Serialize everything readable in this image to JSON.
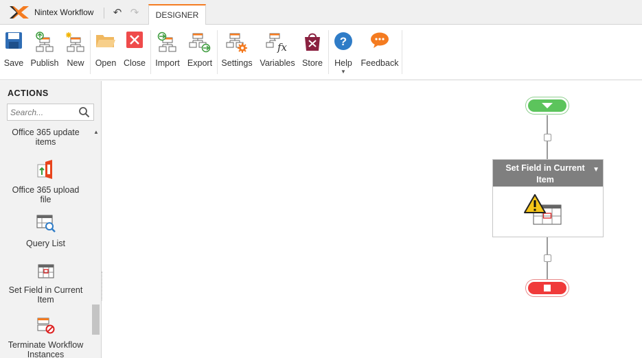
{
  "app": {
    "title": "Nintex Workflow"
  },
  "tabs": [
    {
      "label": "DESIGNER"
    }
  ],
  "ribbon": {
    "buttons": [
      {
        "label": "Save",
        "icon": "save-icon"
      },
      {
        "label": "Publish",
        "icon": "publish-icon"
      },
      {
        "label": "New",
        "icon": "new-workflow-icon"
      },
      {
        "label": "Open",
        "icon": "folder-icon"
      },
      {
        "label": "Close",
        "icon": "close-icon"
      },
      {
        "label": "Import",
        "icon": "import-icon"
      },
      {
        "label": "Export",
        "icon": "export-icon"
      },
      {
        "label": "Settings",
        "icon": "settings-icon"
      },
      {
        "label": "Variables",
        "icon": "variables-icon"
      },
      {
        "label": "Store",
        "icon": "store-icon"
      },
      {
        "label": "Help",
        "icon": "help-icon"
      },
      {
        "label": "Feedback",
        "icon": "feedback-icon"
      }
    ]
  },
  "actions_panel": {
    "title": "ACTIONS",
    "search_placeholder": "Search...",
    "items": [
      {
        "label": "Office 365 update items",
        "icon": "office365-update-icon"
      },
      {
        "label": "Office 365 upload file",
        "icon": "office365-upload-icon"
      },
      {
        "label": "Query List",
        "icon": "query-list-icon"
      },
      {
        "label": "Set Field in Current Item",
        "icon": "set-field-icon"
      },
      {
        "label": "Terminate Workflow Instances",
        "icon": "terminate-workflow-icon"
      }
    ]
  },
  "canvas": {
    "action": {
      "title": "Set Field in Current Item",
      "status": "warning"
    }
  },
  "colors": {
    "accent": "#f47b20",
    "start": "#5cc45c",
    "end": "#f03a3a",
    "action_header": "#7f7f7f",
    "warning": "#f5c518"
  }
}
